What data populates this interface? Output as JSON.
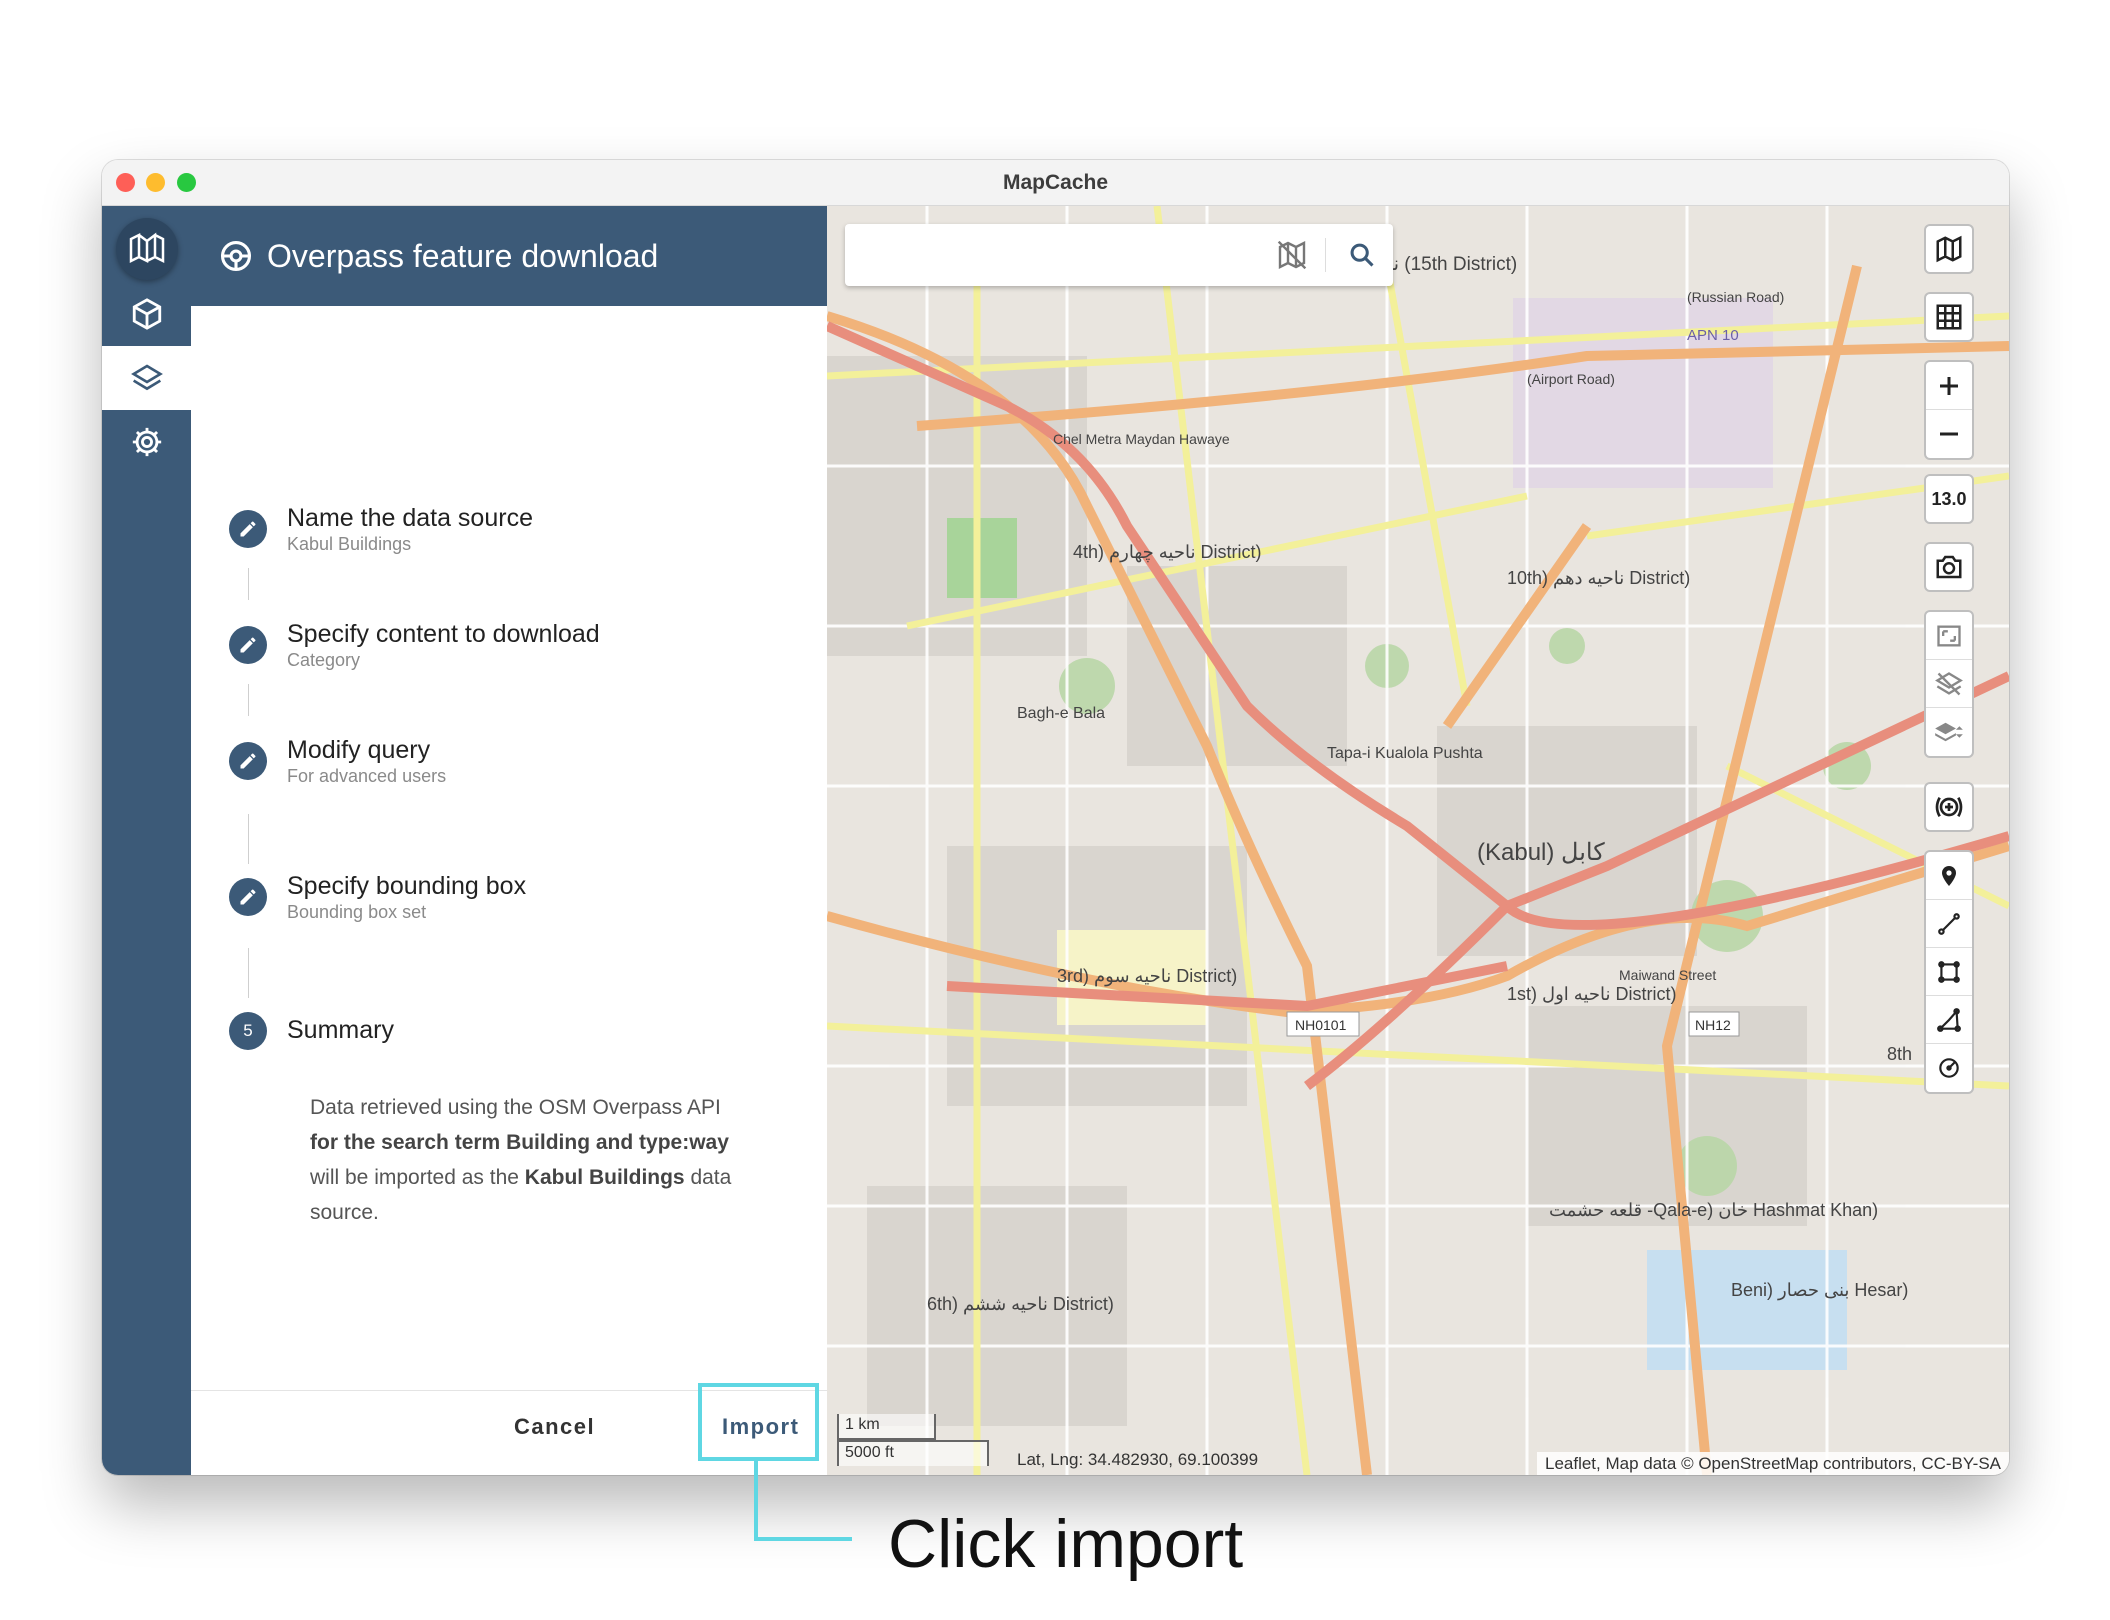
{
  "window": {
    "title": "MapCache"
  },
  "panel": {
    "title": "Overpass feature download",
    "steps": [
      {
        "title": "Name the data source",
        "subtitle": "Kabul Buildings"
      },
      {
        "title": "Specify content to download",
        "subtitle": "Category"
      },
      {
        "title": "Modify query",
        "subtitle": "For advanced users"
      },
      {
        "title": "Specify bounding box",
        "subtitle": "Bounding box set"
      },
      {
        "number": "5",
        "title": "Summary"
      }
    ],
    "summary": {
      "line1": "Data retrieved using the OSM Overpass API",
      "bold1": "for the search term Building and type:way",
      "line2": "will be imported as the",
      "bold2": "Kabul Buildings",
      "line3": "data source."
    },
    "cancel_label": "Cancel",
    "import_label": "Import"
  },
  "map": {
    "zoom_level": "13.0",
    "scale_km": "1 km",
    "scale_ft": "5000 ft",
    "latlng": "Lat, Lng: 34.482930, 69.100399",
    "attribution": "Leaflet, Map data © OpenStreetMap contributors, CC-BY-SA",
    "labels": {
      "district_15": "ناحیه پانزدهم (15th District)",
      "district_4": "4th) ناحیه چهارم District)",
      "district_10": "10th) ناحیه دهم District)",
      "kabul": "(Kabul) کابل",
      "district_3": "3rd) ناحیه سوم District)",
      "district_1": "1st) ناحیه اول District)",
      "district_6": "6th) ناحیه ششم District)",
      "district_8": "8th",
      "bagh_e_bala": "Bagh-e Bala",
      "tapa": "Tapa-i Kualola Pushta",
      "qala": "قلعه حشمت -Qala-e) خان Hashmat Khan)",
      "beni_hesar": "Beni) بنی حصار Hesar)",
      "airport": "APN 10",
      "road_chel_metra": "Chel Metra Maydan Hawaye",
      "road_airport": "(Airport Road)",
      "road_maiwand": "Maiwand Street",
      "road_nh0101": "NH0101",
      "road_nh12": "NH12",
      "road_russian": "(Russian Road)"
    }
  },
  "annotation": {
    "caption": "Click import"
  }
}
